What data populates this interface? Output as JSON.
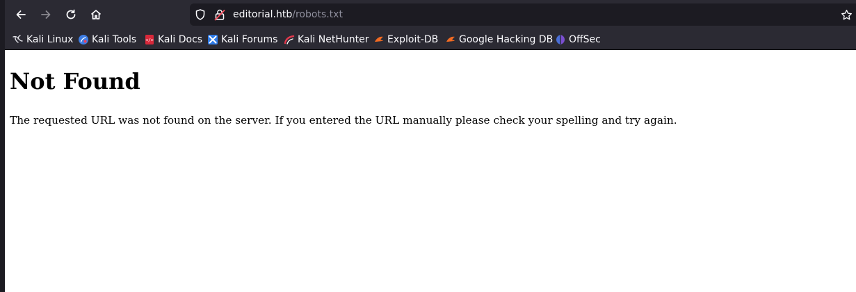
{
  "browser": {
    "url_host": "editorial.htb",
    "url_path": "/robots.txt",
    "nav_icons": [
      "back-arrow-icon",
      "forward-arrow-icon",
      "reload-icon",
      "home-icon"
    ],
    "colors": {
      "toolbar": "#2b2a33",
      "urlbar": "#1c1b22",
      "text": "#fbfbfe",
      "muted": "#8f8f9d"
    }
  },
  "bookmarks": [
    {
      "label": "Kali Linux",
      "icon": "kali-dragon-icon"
    },
    {
      "label": "Kali Tools",
      "icon": "kali-tools-icon"
    },
    {
      "label": "Kali Docs",
      "icon": "kali-docs-icon"
    },
    {
      "label": "Kali Forums",
      "icon": "kali-forums-icon"
    },
    {
      "label": "Kali NetHunter",
      "icon": "kali-nethunter-icon"
    },
    {
      "label": "Exploit-DB",
      "icon": "exploit-db-icon"
    },
    {
      "label": "Google Hacking DB",
      "icon": "ghdb-icon"
    },
    {
      "label": "OffSec",
      "icon": "offsec-icon"
    }
  ],
  "page": {
    "heading": "Not Found",
    "message": "The requested URL was not found on the server. If you entered the URL manually please check your spelling and try again."
  }
}
